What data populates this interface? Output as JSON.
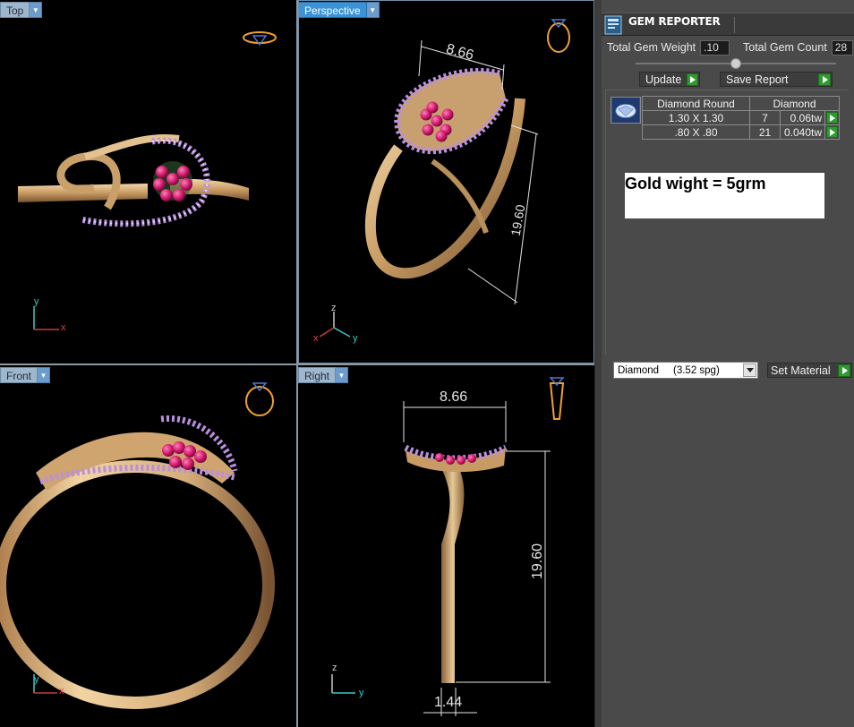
{
  "viewports": {
    "top": {
      "label": "Top"
    },
    "perspective": {
      "label": "Perspective"
    },
    "front": {
      "label": "Front"
    },
    "right": {
      "label": "Right"
    }
  },
  "dimensions": {
    "width": "8.66",
    "height": "19.60",
    "band_thickness": "1.44"
  },
  "axes": {
    "x": "x",
    "y": "y",
    "z": "z"
  },
  "gem_reporter": {
    "title": "GEM REPORTER",
    "total_weight_label": "Total Gem Weight",
    "total_weight_value": ".10",
    "total_count_label": "Total Gem Count",
    "total_count_value": "28",
    "update_label": "Update",
    "save_report_label": "Save Report",
    "table": {
      "headers": [
        "Diamond Round",
        "Diamond"
      ],
      "rows": [
        {
          "size": "1.30 X 1.30",
          "count": "7",
          "weight": "0.06tw"
        },
        {
          "size": ".80 X .80",
          "count": "21",
          "weight": "0.040tw"
        }
      ]
    },
    "note": "Gold wight = 5grm",
    "material_select": "Diamond     (3.52 spg)",
    "set_material_label": "Set Material"
  },
  "colors": {
    "gold": "#d8b07c",
    "ruby": "#d0186a",
    "diamond_prong": "#b98fe0",
    "active_tab": "#3b93d6"
  }
}
